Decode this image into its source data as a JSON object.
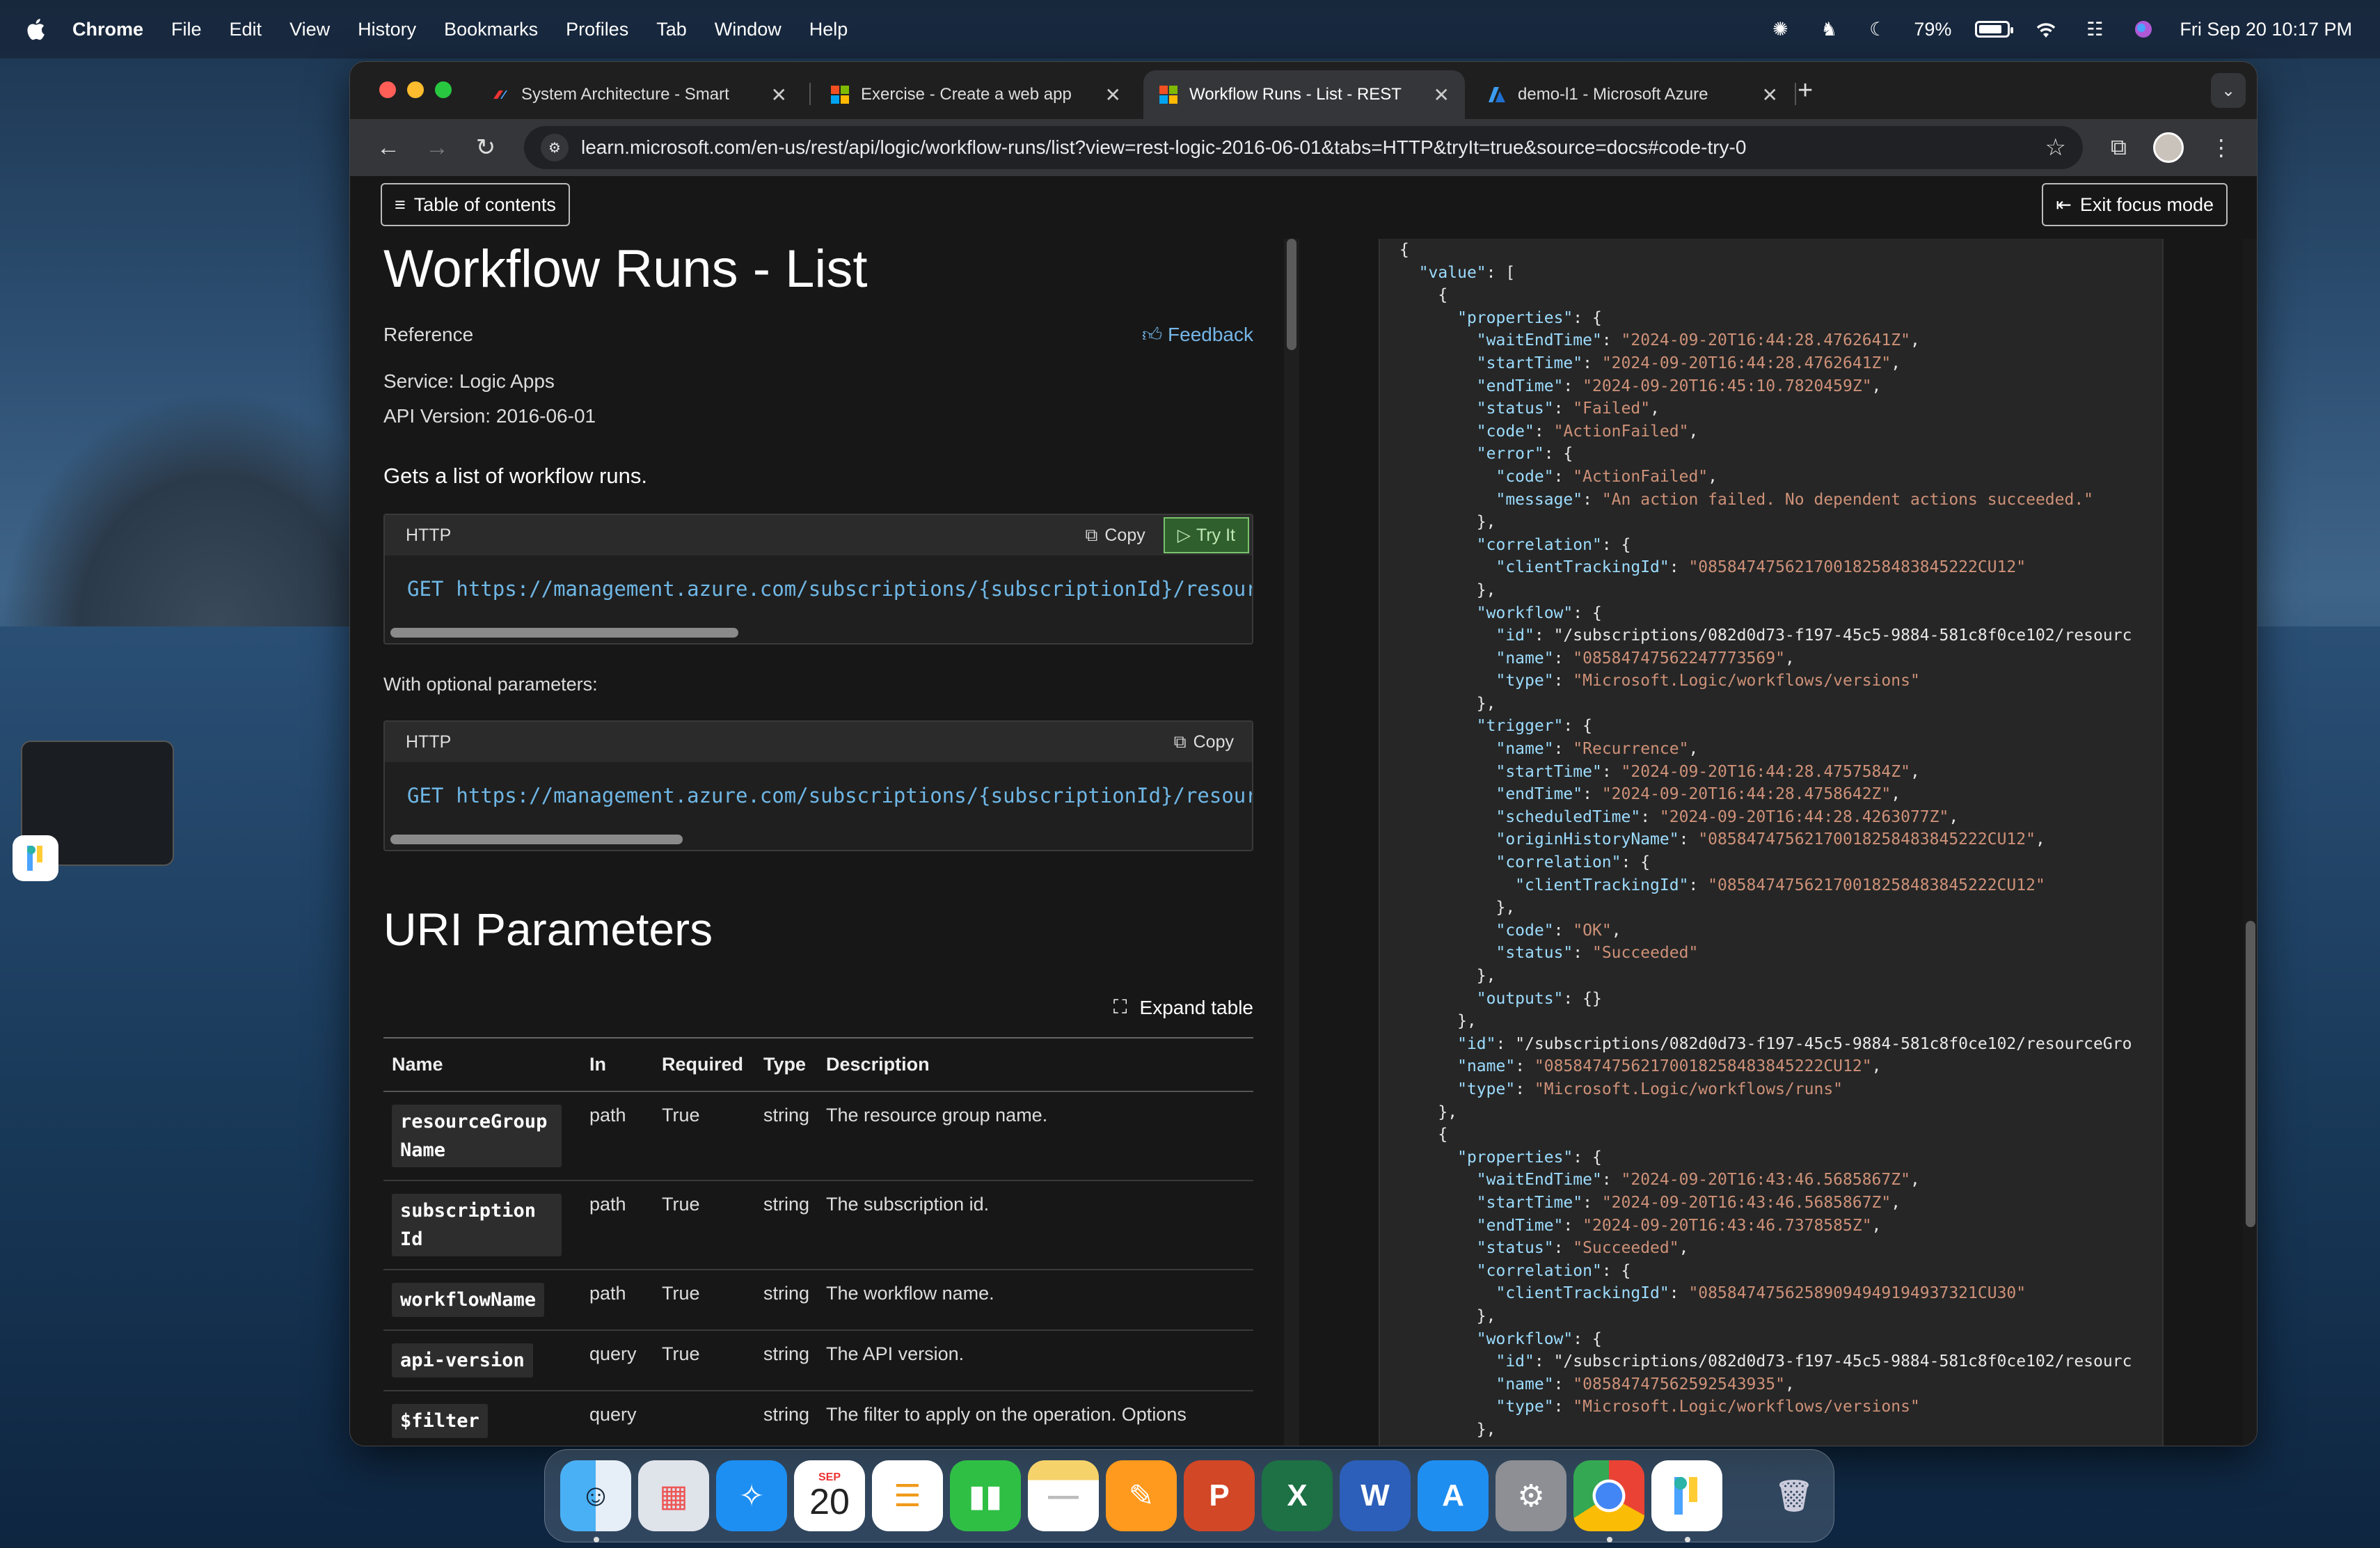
{
  "menubar": {
    "app": "Chrome",
    "items": [
      "File",
      "Edit",
      "View",
      "History",
      "Bookmarks",
      "Profiles",
      "Tab",
      "Window",
      "Help"
    ],
    "battery": "79%",
    "datetime": "Fri Sep 20  10:17 PM"
  },
  "tabs": [
    {
      "title": "System Architecture - Smart",
      "active": false
    },
    {
      "title": "Exercise - Create a web app",
      "active": false
    },
    {
      "title": "Workflow Runs - List - REST",
      "active": true
    },
    {
      "title": "demo-l1 - Microsoft Azure",
      "active": false
    }
  ],
  "omnibox": {
    "url": "learn.microsoft.com/en-us/rest/api/logic/workflow-runs/list?view=rest-logic-2016-06-01&tabs=HTTP&tryIt=true&source=docs#code-try-0"
  },
  "page": {
    "toc_label": "Table of contents",
    "exit_focus_label": "Exit focus mode",
    "title": "Workflow Runs - List",
    "reference": "Reference",
    "feedback": "Feedback",
    "service_label": "Service:",
    "service": "Logic Apps",
    "api_label": "API Version:",
    "api_version": "2016-06-01",
    "description": "Gets a list of workflow runs.",
    "http_label": "HTTP",
    "copy_label": "Copy",
    "tryit_label": "Try It",
    "method": "GET",
    "request_url": "https://management.azure.com/subscriptions/{subscriptionId}/resource",
    "optional_label": "With optional parameters:",
    "uri_heading": "URI Parameters",
    "expand_label": "Expand table",
    "columns": [
      "Name",
      "In",
      "Required",
      "Type",
      "Description"
    ],
    "rows": [
      {
        "name": "resourceGroup Name",
        "in": "path",
        "required": "True",
        "type": "string",
        "desc": "The resource group name."
      },
      {
        "name": "subscription Id",
        "in": "path",
        "required": "True",
        "type": "string",
        "desc": "The subscription id."
      },
      {
        "name": "workflowName",
        "in": "path",
        "required": "True",
        "type": "string",
        "desc": "The workflow name."
      },
      {
        "name": "api-version",
        "in": "query",
        "required": "True",
        "type": "string",
        "desc": "The API version."
      },
      {
        "name": "$filter",
        "in": "query",
        "required": "",
        "type": "string",
        "desc": "The filter to apply on the operation. Options"
      }
    ]
  },
  "json_lines": [
    "{",
    "  \"value\": [",
    "    {",
    "      \"properties\": {",
    "        \"waitEndTime\": \"2024-09-20T16:44:28.4762641Z\",",
    "        \"startTime\": \"2024-09-20T16:44:28.4762641Z\",",
    "        \"endTime\": \"2024-09-20T16:45:10.7820459Z\",",
    "        \"status\": \"Failed\",",
    "        \"code\": \"ActionFailed\",",
    "        \"error\": {",
    "          \"code\": \"ActionFailed\",",
    "          \"message\": \"An action failed. No dependent actions succeeded.\"",
    "        },",
    "        \"correlation\": {",
    "          \"clientTrackingId\": \"08584747562170018258483845222CU12\"",
    "        },",
    "        \"workflow\": {",
    "          \"id\": \"/subscriptions/082d0d73-f197-45c5-9884-581c8f0ce102/resourc",
    "          \"name\": \"08584747562247773569\",",
    "          \"type\": \"Microsoft.Logic/workflows/versions\"",
    "        },",
    "        \"trigger\": {",
    "          \"name\": \"Recurrence\",",
    "          \"startTime\": \"2024-09-20T16:44:28.4757584Z\",",
    "          \"endTime\": \"2024-09-20T16:44:28.4758642Z\",",
    "          \"scheduledTime\": \"2024-09-20T16:44:28.4263077Z\",",
    "          \"originHistoryName\": \"08584747562170018258483845222CU12\",",
    "          \"correlation\": {",
    "            \"clientTrackingId\": \"08584747562170018258483845222CU12\"",
    "          },",
    "          \"code\": \"OK\",",
    "          \"status\": \"Succeeded\"",
    "        },",
    "        \"outputs\": {}",
    "      },",
    "      \"id\": \"/subscriptions/082d0d73-f197-45c5-9884-581c8f0ce102/resourceGro",
    "      \"name\": \"08584747562170018258483845222CU12\",",
    "      \"type\": \"Microsoft.Logic/workflows/runs\"",
    "    },",
    "    {",
    "      \"properties\": {",
    "        \"waitEndTime\": \"2024-09-20T16:43:46.5685867Z\",",
    "        \"startTime\": \"2024-09-20T16:43:46.5685867Z\",",
    "        \"endTime\": \"2024-09-20T16:43:46.7378585Z\",",
    "        \"status\": \"Succeeded\",",
    "        \"correlation\": {",
    "          \"clientTrackingId\": \"08584747562589094949194937321CU30\"",
    "        },",
    "        \"workflow\": {",
    "          \"id\": \"/subscriptions/082d0d73-f197-45c5-9884-581c8f0ce102/resourc",
    "          \"name\": \"08584747562592543935\",",
    "          \"type\": \"Microsoft.Logic/workflows/versions\"",
    "        },"
  ],
  "dock": {
    "calendar_month": "SEP",
    "calendar_day": "20",
    "apps": [
      "Finder",
      "Launchpad",
      "Safari",
      "Calendar",
      "Reminders",
      "Numbers",
      "Notes",
      "Pages",
      "PowerPoint",
      "Excel",
      "Word",
      "App Store",
      "System Settings",
      "Chrome",
      "Passwords",
      "Trash"
    ]
  },
  "colors": {
    "accent": "#75b6e7",
    "try_it": "#2f5f2c",
    "json_key": "#9cdcfe",
    "json_string": "#ce9178"
  }
}
